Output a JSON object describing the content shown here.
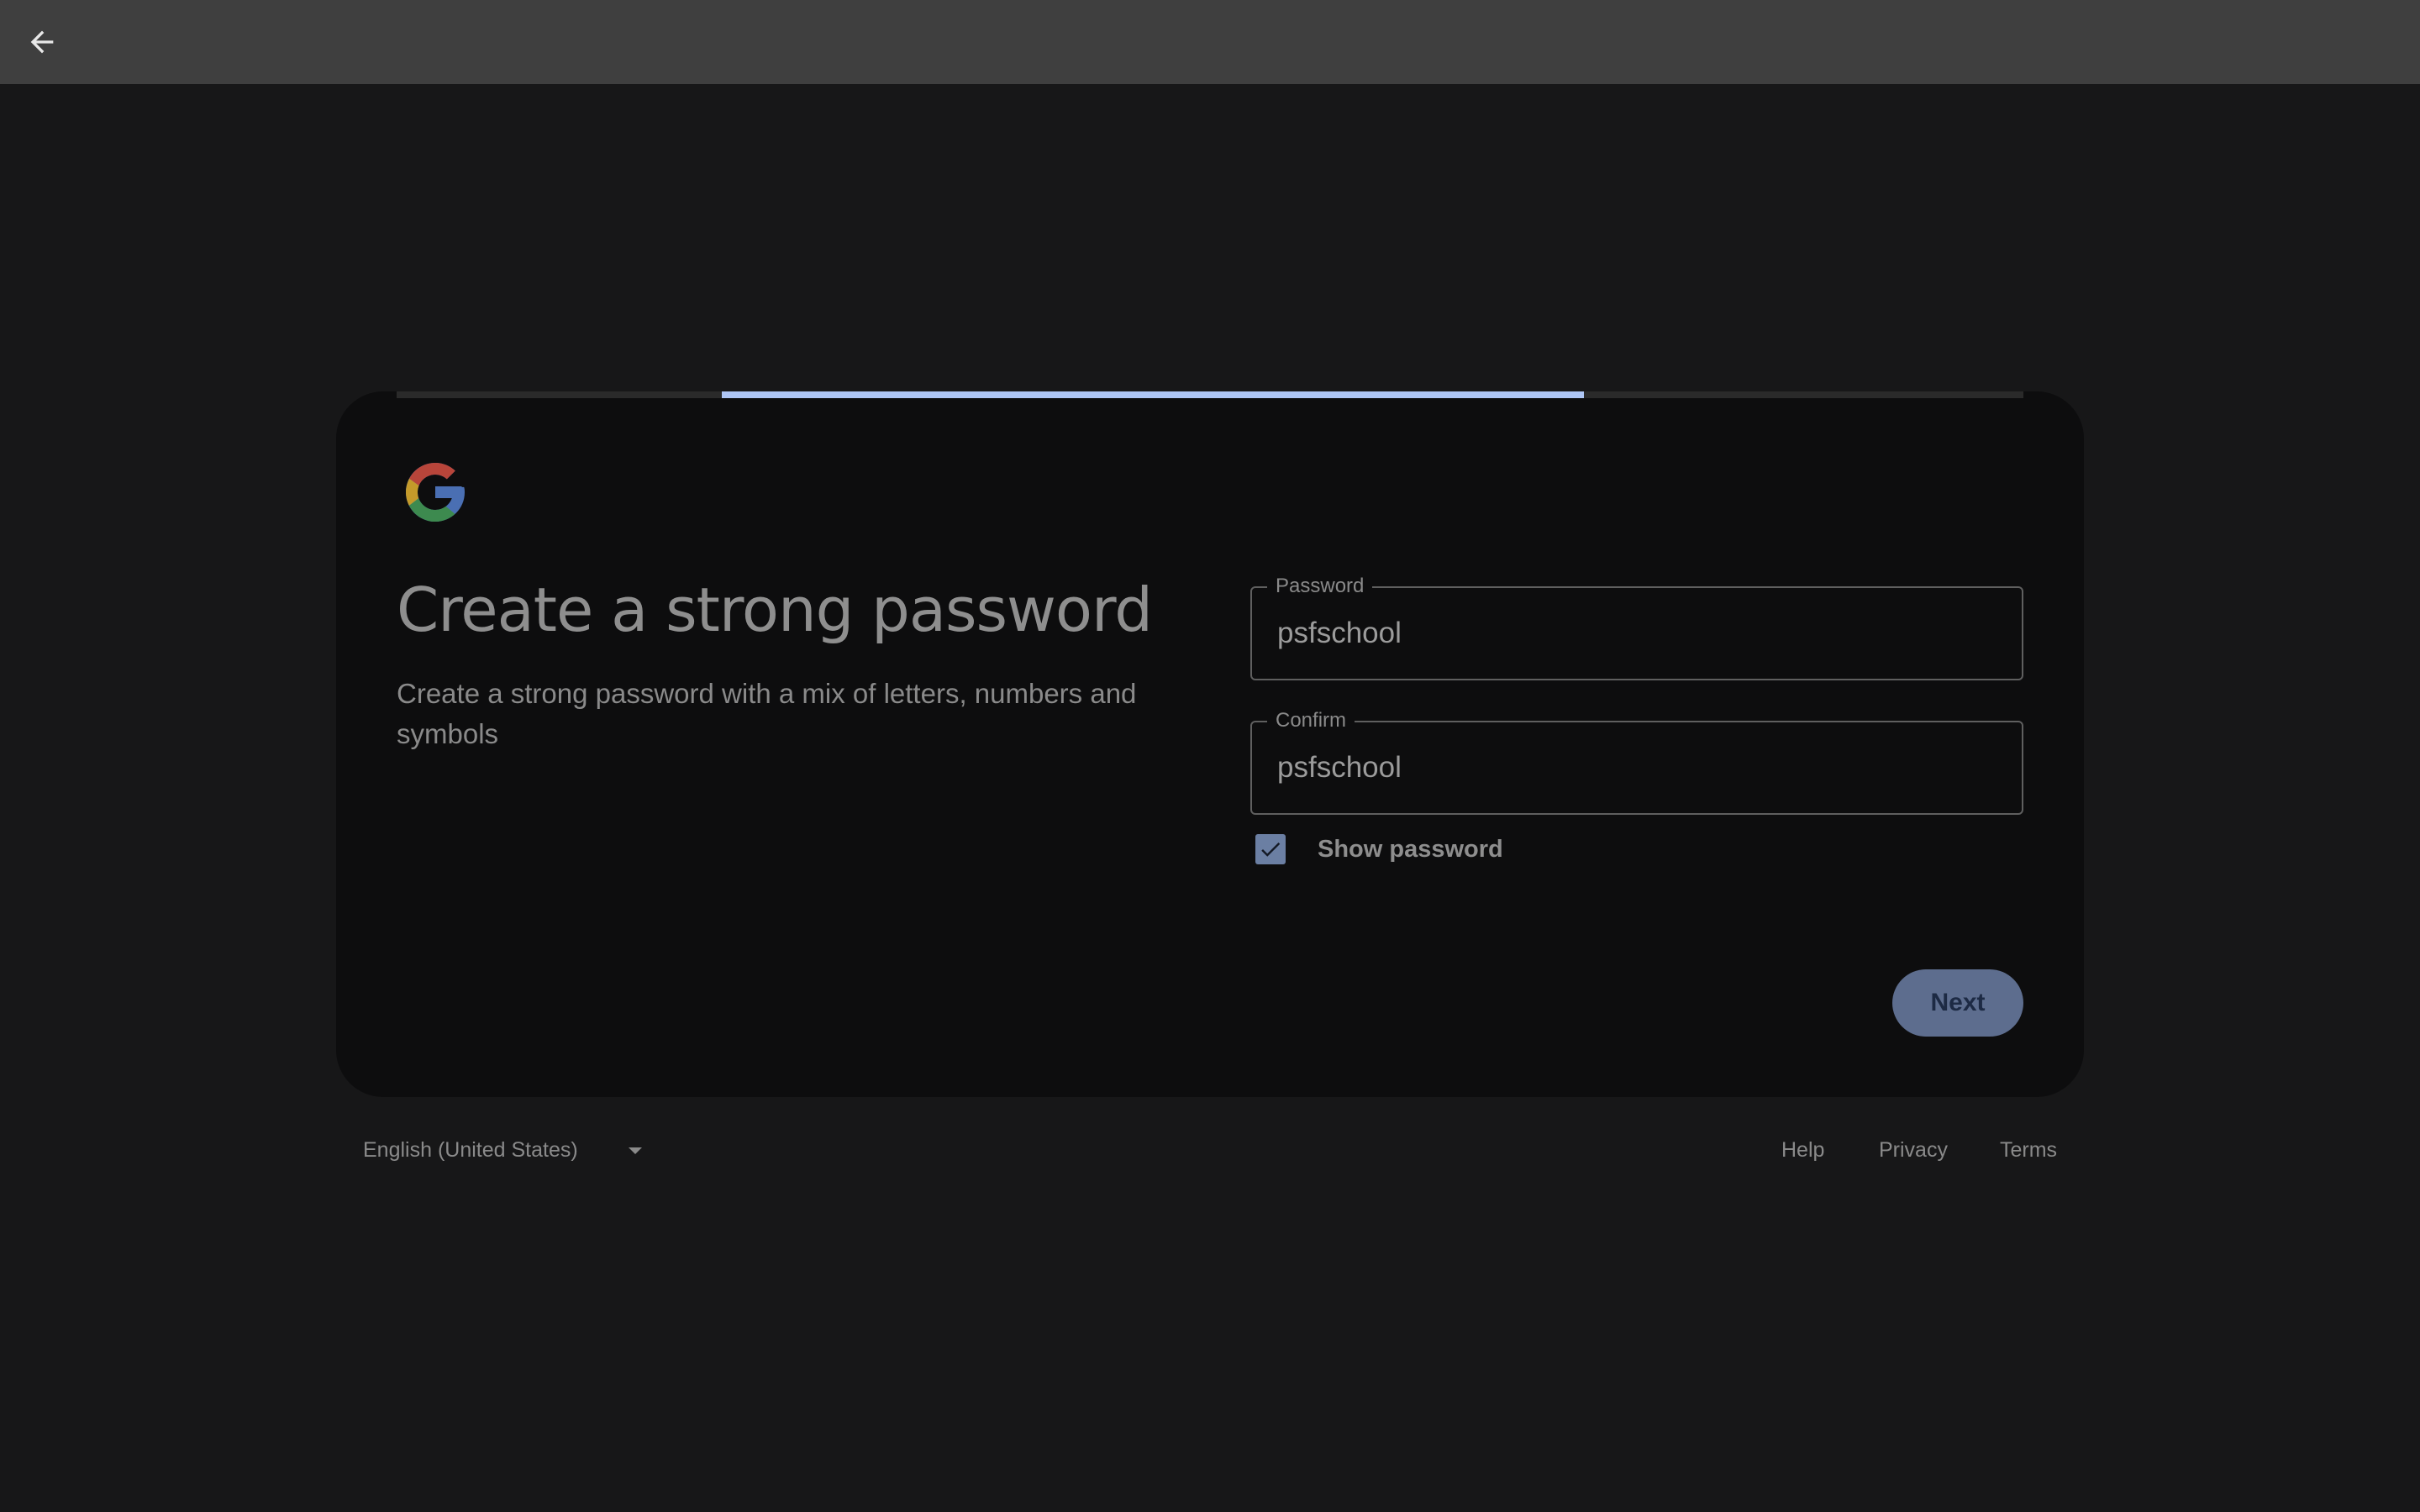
{
  "topbar": {
    "back_icon": "arrow-left-icon"
  },
  "progress": {
    "filled_fraction_start": 0.2,
    "filled_fraction_end": 0.73,
    "fill_color": "#aec6f5"
  },
  "card": {
    "logo": "google-g-logo",
    "title": "Create a strong password",
    "subtitle": "Create a strong password with a mix of letters, numbers and symbols"
  },
  "form": {
    "password": {
      "label": "Password",
      "value": "psfschool"
    },
    "confirm": {
      "label": "Confirm",
      "value": "psfschool"
    },
    "show_password": {
      "label": "Show password",
      "checked": true
    },
    "next_label": "Next"
  },
  "footer": {
    "language": "English (United States)",
    "links": [
      "Help",
      "Privacy",
      "Terms"
    ]
  },
  "colors": {
    "background": "#171718",
    "topbar": "#3f3f3f",
    "card": "#0d0d0e",
    "accent": "#5d6d8e"
  }
}
